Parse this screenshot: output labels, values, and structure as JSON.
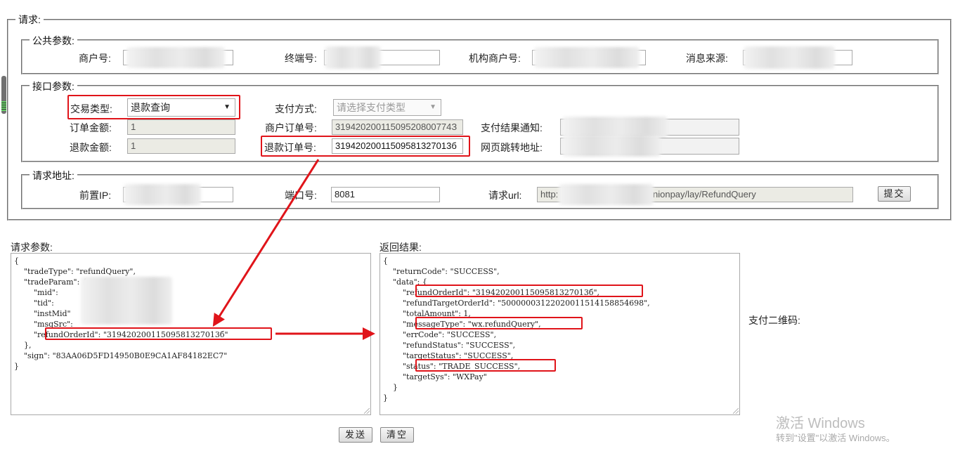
{
  "request": {
    "legend": "请求:",
    "public_params": {
      "legend": "公共参数:",
      "merchant_no_label": "商户号:",
      "terminal_no_label": "终端号:",
      "org_merchant_no_label": "机构商户号:",
      "message_source_label": "消息来源:"
    },
    "interface_params": {
      "legend": "接口参数:",
      "trade_type_label": "交易类型:",
      "trade_type_value": "退款查询",
      "pay_method_label": "支付方式:",
      "pay_method_placeholder": "请选择支付类型",
      "order_amount_label": "订单金额:",
      "order_amount_value": "1",
      "merchant_order_label": "商户订单号:",
      "merchant_order_value": "31942020011509520800774З",
      "pay_result_notify_label": "支付结果通知:",
      "refund_amount_label": "退款金额:",
      "refund_amount_value": "1",
      "refund_order_label": "退款订单号:",
      "refund_order_value": "31942020011509581327013б",
      "page_redirect_label": "网页跳转地址:"
    },
    "address": {
      "legend": "请求地址:",
      "front_ip_label": "前置IP:",
      "port_label": "端口号:",
      "port_value": "8081",
      "url_label": "请求url:",
      "url_prefix": "http:",
      "url_suffix": "nionpay/lay/RefundQuery",
      "submit_label": "提交"
    }
  },
  "request_params": {
    "label": "请求参数:",
    "lines": [
      "{",
      "    \"tradeType\": \"refundQuery\",",
      "    \"tradeParam\": {",
      "        \"mid\":",
      "        \"tid\":",
      "        \"instMid\"",
      "        \"msgSrc\":",
      "        \"refundOrderId\": \"31942020011509581327013б\"",
      "    },",
      "    \"sign\": \"83AA06D5FD14950B0E9CA1AF84182EC7\"",
      "}"
    ]
  },
  "response": {
    "label": "返回结果:",
    "lines": [
      "{",
      "    \"returnCode\": \"SUCCESS\",",
      "    \"data\": {",
      "        \"refundOrderId\": \"31942020011509581327013б\",",
      "        \"refundTargetOrderId\": \"50000003122020011514158854698\",",
      "        \"totalAmount\": 1,",
      "        \"messageType\": \"wx.refundQuery\",",
      "        \"errCode\": \"SUCCESS\",",
      "        \"refundStatus\": \"SUCCESS\",",
      "        \"targetStatus\": \"SUCCESS\",",
      "        \"status\": \"TRADE_SUCCESS\",",
      "        \"targetSys\": \"WXPay\"",
      "    }",
      "}"
    ]
  },
  "qr_label": "支付二维码:",
  "send_label": "发送",
  "clear_label": "清空",
  "watermark": {
    "title": "激活 Windows",
    "subtitle": "转到\"设置\"以激活 Windows。"
  },
  "colors": {
    "highlight": "#e0141a",
    "readonly_bg": "#ebebe4"
  }
}
